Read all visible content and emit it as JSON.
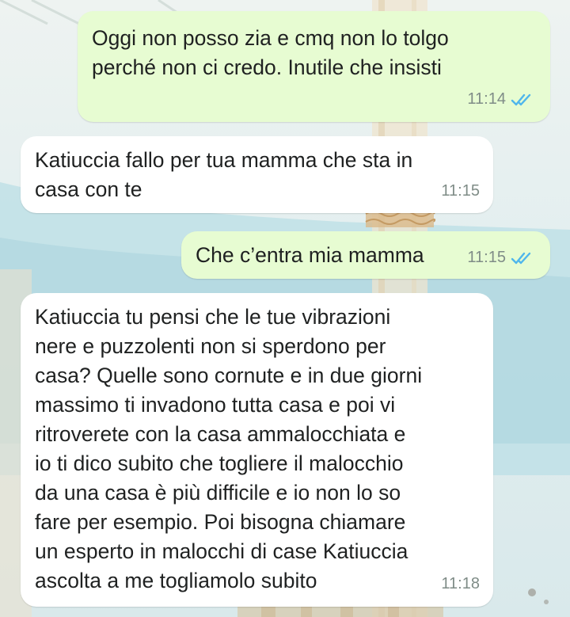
{
  "chat": {
    "messages": [
      {
        "direction": "outgoing",
        "text": "Oggi non posso zia e cmq non lo tolgo\nperché non ci credo. Inutile che insisti",
        "time": "11:14",
        "status_icon": "double-check-read-icon"
      },
      {
        "direction": "incoming",
        "text": "Katiuccia fallo per tua mamma che sta in\ncasa con te",
        "time": "11:15"
      },
      {
        "direction": "outgoing",
        "text": "Che c’entra mia mamma",
        "time": "11:15",
        "status_icon": "double-check-read-icon"
      },
      {
        "direction": "incoming",
        "text": "Katiuccia tu pensi che le tue vibrazioni\nnere e puzzolenti non si sperdono per\ncasa? Quelle sono cornute e in due giorni\nmassimo ti invadono tutta casa e poi vi\nritroverete con la casa ammalocchiata e\nio ti dico subito che togliere il malocchio\nda una casa è più difficile e io non lo so\nfare per esempio. Poi bisogna chiamare\nun esperto in malocchi di case Katiuccia\nascolta a me togliamolo subito",
        "time": "11:18"
      }
    ]
  },
  "colors": {
    "outgoing_bubble": "#e7fcd2",
    "incoming_bubble": "#ffffff",
    "read_ticks": "#4fb6ec",
    "timestamp": "#7f8c87",
    "wallpaper_sky": "#e3eef0",
    "wallpaper_water": "#b9dde4"
  }
}
